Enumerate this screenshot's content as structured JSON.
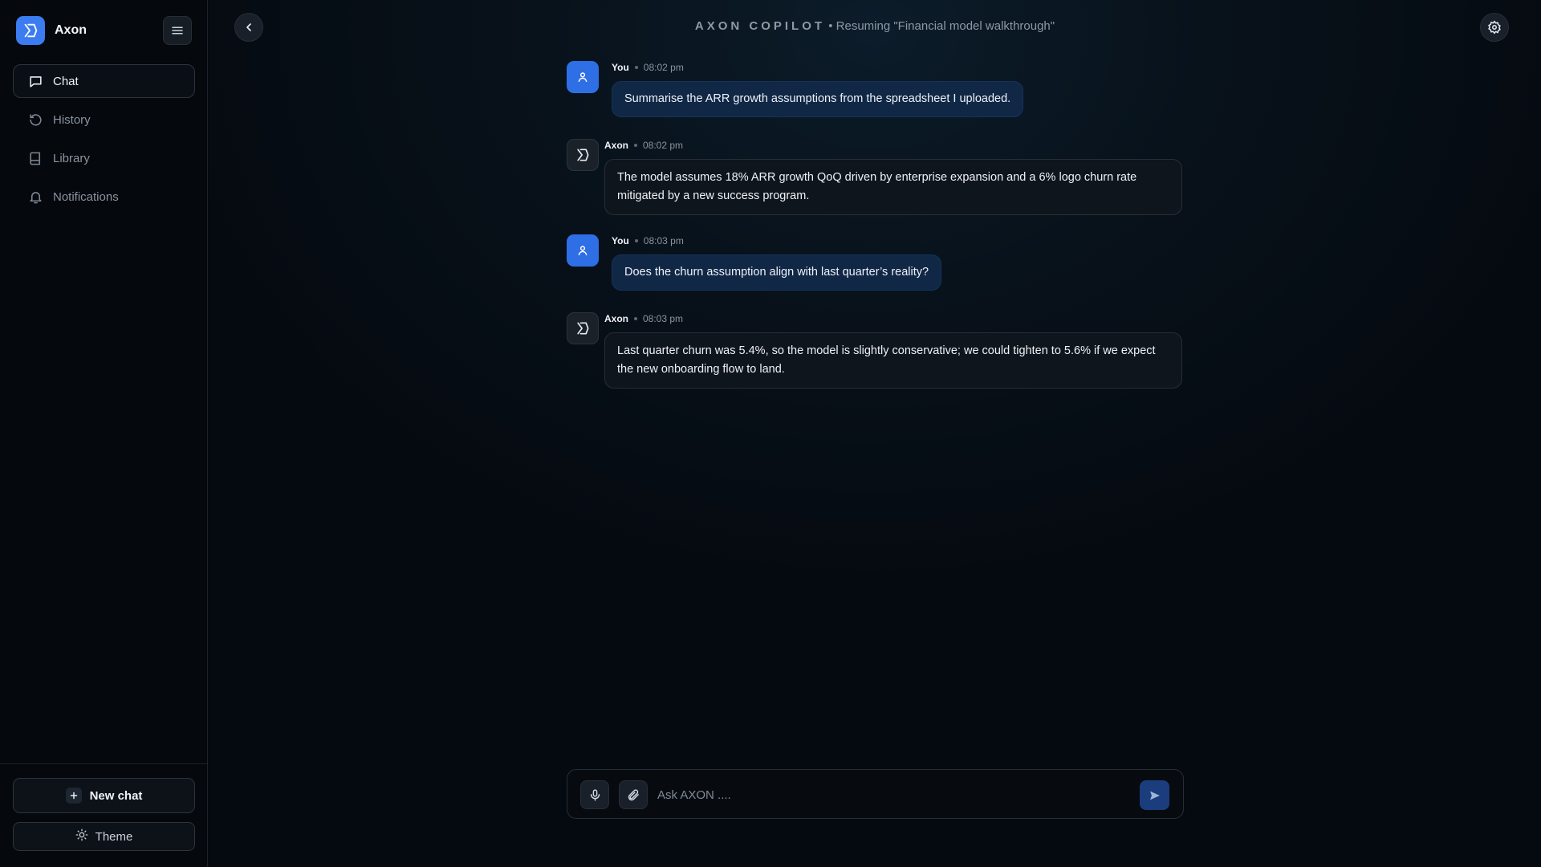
{
  "app": {
    "name": "Axon"
  },
  "sidebar": {
    "items": [
      {
        "label": "Chat",
        "icon": "chat-bubble-icon",
        "active": true
      },
      {
        "label": "History",
        "icon": "history-icon",
        "active": false
      },
      {
        "label": "Library",
        "icon": "book-icon",
        "active": false
      },
      {
        "label": "Notifications",
        "icon": "bell-icon",
        "active": false
      }
    ],
    "new_chat_label": "New chat",
    "theme_label": "Theme"
  },
  "header": {
    "brand": "AXON COPILOT",
    "separator": "•",
    "subtitle": "Resuming \"Financial model walkthrough\""
  },
  "messages": [
    {
      "author": "You",
      "time": "08:02 pm",
      "role": "user",
      "text": "Summarise the ARR growth assumptions from the spreadsheet I uploaded."
    },
    {
      "author": "Axon",
      "time": "08:02 pm",
      "role": "assistant",
      "text": "The model assumes 18% ARR growth QoQ driven by enterprise expansion and a 6% logo churn rate mitigated by a new success program."
    },
    {
      "author": "You",
      "time": "08:03 pm",
      "role": "user",
      "text": "Does the churn assumption align with last quarter’s reality?"
    },
    {
      "author": "Axon",
      "time": "08:03 pm",
      "role": "assistant",
      "text": "Last quarter churn was 5.4%, so the model is slightly conservative; we could tighten to 5.6% if we expect the new onboarding flow to land."
    }
  ],
  "composer": {
    "placeholder": "Ask AXON ....",
    "value": ""
  },
  "colors": {
    "accent": "#3b7cf0",
    "user_bubble": "#102746",
    "assistant_bubble": "#0f151c",
    "background": "#050a10"
  }
}
